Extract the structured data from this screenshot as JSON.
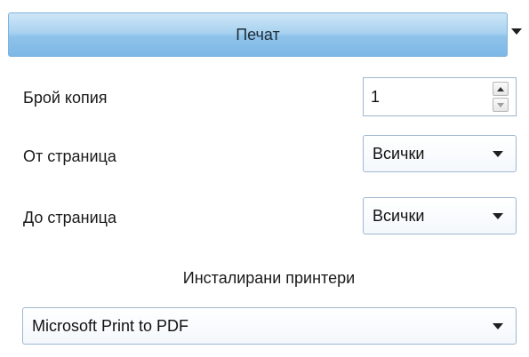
{
  "header": {
    "title": "Печат"
  },
  "copies": {
    "label": "Брой копия",
    "value": "1"
  },
  "from_page": {
    "label": "От страница",
    "selected": "Всички"
  },
  "to_page": {
    "label": "До страница",
    "selected": "Всички"
  },
  "printers": {
    "heading": "Инсталирани принтери",
    "selected": "Microsoft Print to PDF"
  },
  "icons": {
    "dropdown": "chevron-down-icon",
    "spin_up": "spin-up-icon",
    "spin_down": "spin-down-icon"
  }
}
